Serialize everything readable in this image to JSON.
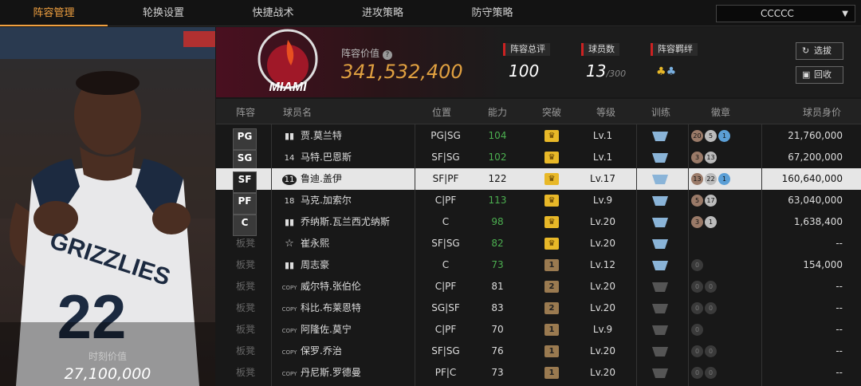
{
  "nav": {
    "tabs": [
      "阵容管理",
      "轮换设置",
      "快捷战术",
      "进攻策略",
      "防守策略"
    ],
    "active_tab": 0,
    "team_select": "CCCCC"
  },
  "hero": {
    "jersey_team": "GRIZZLIES",
    "jersey_number": "22",
    "value_label": "时刻价值",
    "value": "27,100,000"
  },
  "summary": {
    "team_logo_text": "MIAMI",
    "lineup_value_label": "阵容价值",
    "lineup_value": "341,532,400",
    "rating_label": "阵容总评",
    "rating": "100",
    "player_count_label": "球员数",
    "player_count": "13",
    "player_count_max": "/300",
    "bond_label": "阵容羁绊",
    "btn_pick": "选拔",
    "btn_recycle": "回收"
  },
  "table": {
    "headers": [
      "阵容",
      "球员名",
      "位置",
      "能力",
      "突破",
      "等级",
      "训练",
      "徽章",
      "球员身价"
    ],
    "rows": [
      {
        "slot": "PG",
        "icon": "bars",
        "name": "贾.莫兰特",
        "pos": "PG|SG",
        "ability": "104",
        "ability_color": "green",
        "breakthrough": "crown",
        "level": "Lv.1",
        "train": "blue",
        "badges": [
          "20",
          "5",
          "1"
        ],
        "value": "21,760,000"
      },
      {
        "slot": "SG",
        "icon": "14",
        "name": "马特.巴恩斯",
        "pos": "SF|SG",
        "ability": "102",
        "ability_color": "green",
        "breakthrough": "crown",
        "level": "Lv.1",
        "train": "blue",
        "badges": [
          "3",
          "13"
        ],
        "value": "67,200,000"
      },
      {
        "slot": "SF",
        "icon": "11",
        "name": "鲁迪.盖伊",
        "pos": "SF|PF",
        "ability": "122",
        "ability_color": "normal",
        "breakthrough": "crown",
        "level": "Lv.17",
        "train": "blue",
        "badges": [
          "13",
          "22",
          "1"
        ],
        "value": "160,640,000",
        "selected": true
      },
      {
        "slot": "PF",
        "icon": "18",
        "name": "马克.加索尔",
        "pos": "C|PF",
        "ability": "113",
        "ability_color": "green",
        "breakthrough": "crown",
        "level": "Lv.9",
        "train": "blue",
        "badges": [
          "5",
          "17"
        ],
        "value": "63,040,000"
      },
      {
        "slot": "C",
        "icon": "bars",
        "name": "乔纳斯.瓦兰西尤纳斯",
        "pos": "C",
        "ability": "98",
        "ability_color": "green",
        "breakthrough": "crown",
        "level": "Lv.20",
        "train": "blue",
        "badges": [
          "3",
          "1"
        ],
        "value": "1,638,400"
      },
      {
        "slot": "板凳",
        "icon": "star",
        "name": "崔永熙",
        "pos": "SF|SG",
        "ability": "82",
        "ability_color": "green",
        "breakthrough": "crown",
        "level": "Lv.20",
        "train": "blue",
        "badges": [],
        "value": "--"
      },
      {
        "slot": "板凳",
        "icon": "bars",
        "name": "周志豪",
        "pos": "C",
        "ability": "73",
        "ability_color": "green",
        "breakthrough": "1",
        "level": "Lv.12",
        "train": "blue",
        "badges": [
          "0"
        ],
        "value": "154,000"
      },
      {
        "slot": "板凳",
        "icon": "COPY",
        "name": "威尔特.张伯伦",
        "pos": "C|PF",
        "ability": "81",
        "ability_color": "normal",
        "breakthrough": "2",
        "level": "Lv.20",
        "train": "gray",
        "badges": [
          "0",
          "0"
        ],
        "value": "--"
      },
      {
        "slot": "板凳",
        "icon": "COPY",
        "name": "科比.布莱恩特",
        "pos": "SG|SF",
        "ability": "83",
        "ability_color": "normal",
        "breakthrough": "2",
        "level": "Lv.20",
        "train": "gray",
        "badges": [
          "0",
          "0"
        ],
        "value": "--"
      },
      {
        "slot": "板凳",
        "icon": "COPY",
        "name": "阿隆佐.莫宁",
        "pos": "C|PF",
        "ability": "70",
        "ability_color": "normal",
        "breakthrough": "1",
        "level": "Lv.9",
        "train": "gray",
        "badges": [
          "0"
        ],
        "value": "--"
      },
      {
        "slot": "板凳",
        "icon": "COPY",
        "name": "保罗.乔治",
        "pos": "SF|SG",
        "ability": "76",
        "ability_color": "normal",
        "breakthrough": "1",
        "level": "Lv.20",
        "train": "gray",
        "badges": [
          "0",
          "0"
        ],
        "value": "--"
      },
      {
        "slot": "板凳",
        "icon": "COPY",
        "name": "丹尼斯.罗德曼",
        "pos": "PF|C",
        "ability": "73",
        "ability_color": "normal",
        "breakthrough": "1",
        "level": "Lv.20",
        "train": "gray",
        "badges": [
          "0",
          "0"
        ],
        "value": "--"
      }
    ]
  },
  "colors": {
    "accent": "#f0a040",
    "green": "#4caf50",
    "crown_gold": "#e8b828",
    "rank_brown": "#9a7a50",
    "train_blue": "#8ab4d8",
    "train_gray": "#555555"
  }
}
